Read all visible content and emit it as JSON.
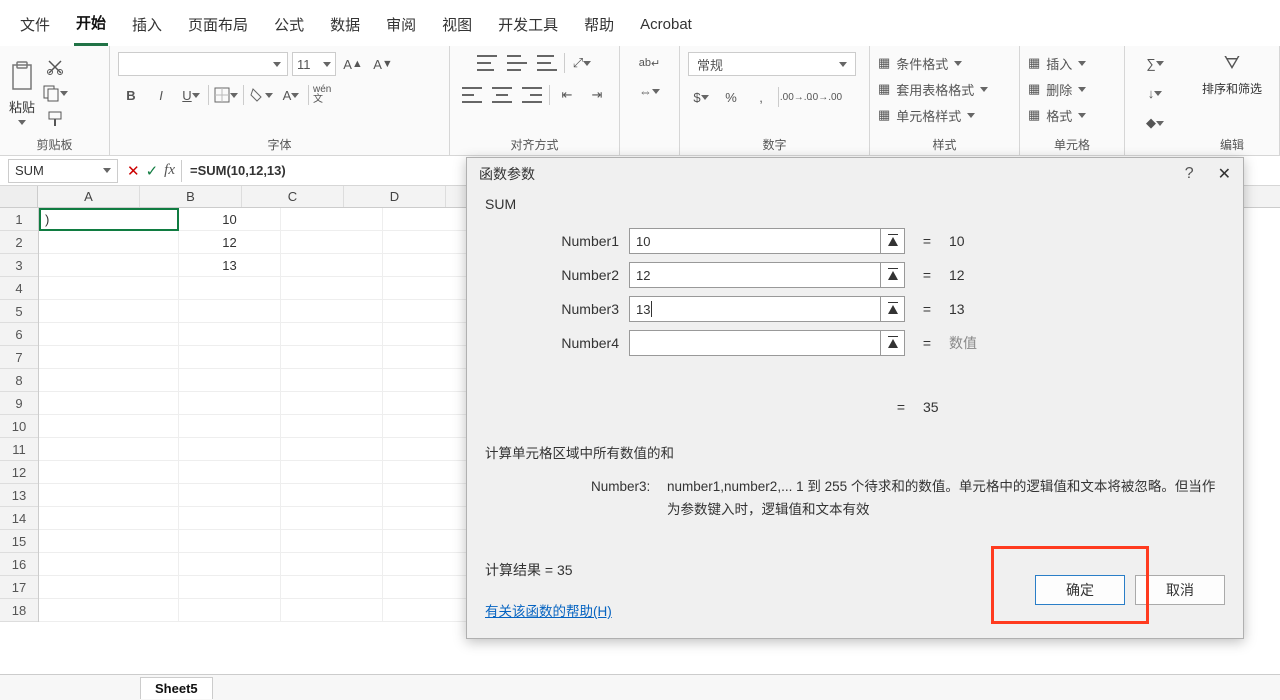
{
  "menu": {
    "items": [
      "文件",
      "开始",
      "插入",
      "页面布局",
      "公式",
      "数据",
      "审阅",
      "视图",
      "开发工具",
      "帮助",
      "Acrobat"
    ],
    "active": 1
  },
  "ribbon": {
    "clipboard": {
      "label": "剪贴板",
      "paste": "粘贴"
    },
    "font": {
      "label": "字体",
      "size": "11",
      "wen": "wén\n文"
    },
    "align": {
      "label": "对齐方式",
      "wrap": "ab"
    },
    "number": {
      "label": "数字",
      "format": "常规"
    },
    "styles": {
      "label": "样式",
      "cond": "条件格式",
      "tbl": "套用表格格式",
      "cell": "单元格样式"
    },
    "cells": {
      "label": "单元格",
      "ins": "插入",
      "del": "删除",
      "fmt": "格式"
    },
    "editing": {
      "label": "编辑",
      "sort": "排序和筛选"
    }
  },
  "formulabar": {
    "name": "SUM",
    "formula": "=SUM(10,12,13)"
  },
  "grid": {
    "cols": [
      "A",
      "B",
      "C",
      "D"
    ],
    "rows": 18,
    "a1": ")",
    "b": [
      "10",
      "12",
      "13"
    ]
  },
  "dialog": {
    "title": "函数参数",
    "func": "SUM",
    "args": [
      {
        "label": "Number1",
        "value": "10",
        "result": "10"
      },
      {
        "label": "Number2",
        "value": "12",
        "result": "12"
      },
      {
        "label": "Number3",
        "value": "13",
        "result": "13"
      },
      {
        "label": "Number4",
        "value": "",
        "result": "数值"
      }
    ],
    "eq": "=",
    "total_result": "35",
    "desc": "计算单元格区域中所有数值的和",
    "arg_name": "Number3:",
    "arg_desc": "number1,number2,... 1 到 255 个待求和的数值。单元格中的逻辑值和文本将被忽略。但当作为参数键入时，逻辑值和文本有效",
    "calc_label": "计算结果 = ",
    "calc_value": "35",
    "help": "有关该函数的帮助(H)",
    "ok": "确定",
    "cancel": "取消"
  },
  "sheettab": "Sheet5"
}
